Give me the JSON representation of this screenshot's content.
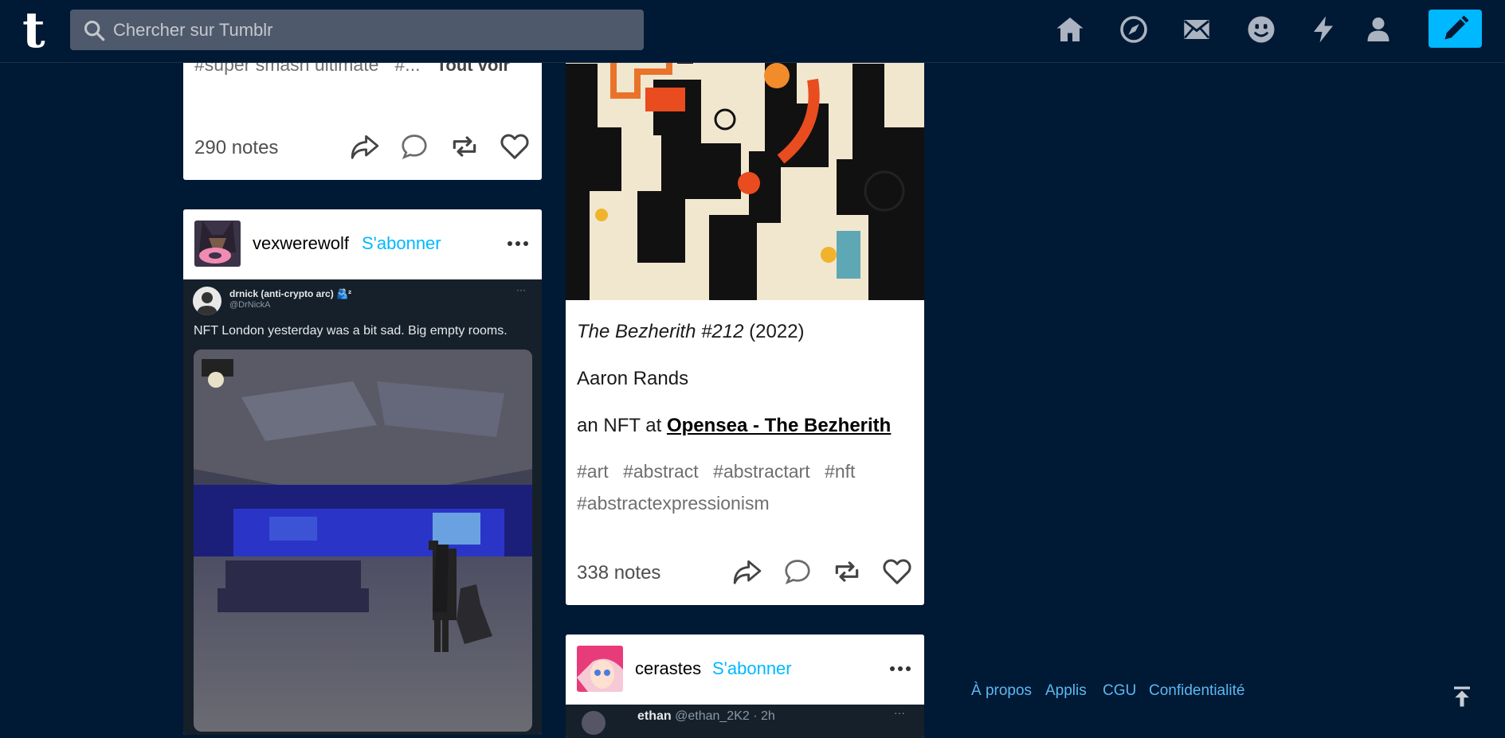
{
  "header": {
    "logo": "t",
    "search_placeholder": "Chercher sur Tumblr"
  },
  "colors": {
    "accent": "#00b8ff",
    "background": "#001935",
    "search_bg": "#4e5a6b"
  },
  "nav_icons": [
    "home-icon",
    "explore-icon",
    "inbox-icon",
    "messaging-icon",
    "activity-icon",
    "account-icon",
    "compose-icon"
  ],
  "post1": {
    "tags_text": "#super smash ultimate",
    "tags_more": "#...",
    "see_all": "Tout voir",
    "notes": "290 notes"
  },
  "post2": {
    "username": "vexwerewolf",
    "follow": "S'abonner",
    "tweet": {
      "author": "drnick (anti-crypto arc) 🫂²",
      "handle": "@DrNickA",
      "text": "NFT London yesterday was a bit sad. Big empty rooms."
    }
  },
  "post3": {
    "title_italic": "The Bezherith #212",
    "title_year": "(2022)",
    "artist": "Aaron Rands",
    "nft_prefix": "an NFT at",
    "nft_link": "Opensea - The Bezherith",
    "tags": [
      "#art",
      "#abstract",
      "#abstractart",
      "#nft",
      "#abstractexpressionism"
    ],
    "notes": "338 notes"
  },
  "post4": {
    "username": "cerastes",
    "follow": "S'abonner",
    "reblog_user": "ethan",
    "reblog_meta": "@ethan_2K2 · 2h"
  },
  "footer": {
    "links": [
      "À propos",
      "Applis",
      "CGU",
      "Confidentialité"
    ]
  }
}
